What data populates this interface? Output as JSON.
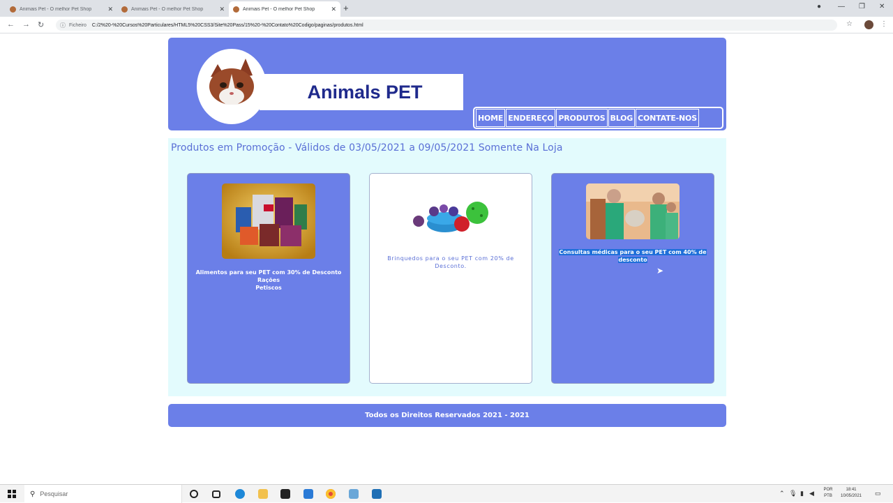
{
  "browser": {
    "tabs": [
      {
        "title": "Animais Pet - O melhor Pet Shop",
        "active": false
      },
      {
        "title": "Animais Pet - O melhor Pet Shop",
        "active": false
      },
      {
        "title": "Animais Pet - O melhor Pet Shop",
        "active": true
      }
    ],
    "new_tab": "+",
    "url_scheme": "Ficheiro",
    "url": "C:/2%20-%20Cursos%20Particulares/HTML5%20CSS3/Site%20Pass/15%20-%20Contato%20Codigo/paginas/produtos.html"
  },
  "header": {
    "site_title": "Animals PET",
    "nav": [
      "HOME",
      "ENDEREÇO",
      "PRODUTOS",
      "BLOG",
      "CONTATE-NOS"
    ]
  },
  "main": {
    "promo_heading": "Produtos em Promoção - Válidos de 03/05/2021 a 09/05/2021 Somente Na Loja",
    "cards": [
      {
        "line1": "Alimentos para seu PET com 30% de Desconto",
        "line2": "Rações",
        "line3": "Petiscos",
        "image": "pet-food-bags-image"
      },
      {
        "line1": "Brinquedos para o seu PET com 20% de",
        "line2": "Desconto.",
        "image": "pet-toys-image"
      },
      {
        "line1": "Consultas médicas para o seu PET com 40% de",
        "line2": "desconto",
        "image": "vet-clinic-image",
        "selected": true
      }
    ]
  },
  "footer": {
    "text": "Todos os Direitos Reservados 2021 - 2021"
  },
  "taskbar": {
    "search_placeholder": "Pesquisar",
    "lang_line1": "POR",
    "lang_line2": "PTB",
    "time": "18:41",
    "date": "10/05/2021"
  },
  "colors": {
    "brand": "#6b7fe8",
    "title": "#1f2a8c",
    "background_panel": "#e3fbfd",
    "selection": "#1e6fd9"
  }
}
